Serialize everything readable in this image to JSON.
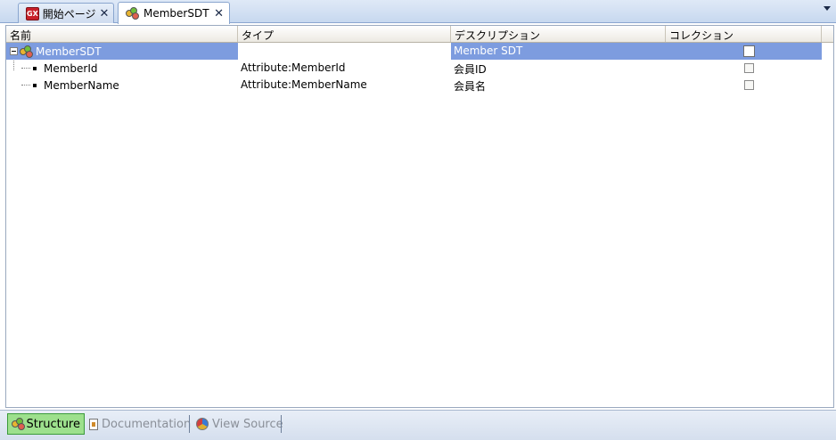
{
  "tabs": [
    {
      "label": "開始ページ",
      "icon": "gx-icon",
      "active": false
    },
    {
      "label": "MemberSDT",
      "icon": "sdt-icon",
      "active": true
    }
  ],
  "gx_icon_text": "GX",
  "close_glyph": "✕",
  "grid": {
    "columns": [
      "名前",
      "タイプ",
      "デスクリプション",
      "コレクション"
    ],
    "rows": [
      {
        "name": "MemberSDT",
        "type": "",
        "description": "Member SDT",
        "collection": false,
        "selected": true
      },
      {
        "name": "MemberId",
        "type": "Attribute:MemberId",
        "description": "会員ID",
        "collection": false,
        "selected": false
      },
      {
        "name": "MemberName",
        "type": "Attribute:MemberName",
        "description": "会員名",
        "collection": false,
        "selected": false
      }
    ]
  },
  "bottom_tabs": [
    {
      "label": "Structure",
      "icon": "structure-icon",
      "active": true
    },
    {
      "label": "Documentation",
      "icon": "documentation-icon",
      "active": false
    },
    {
      "label": "View Source",
      "icon": "view-source-icon",
      "active": false
    }
  ],
  "colors": {
    "selection": "#7d9cdf",
    "active_bottom_tab": "#9de08d"
  }
}
